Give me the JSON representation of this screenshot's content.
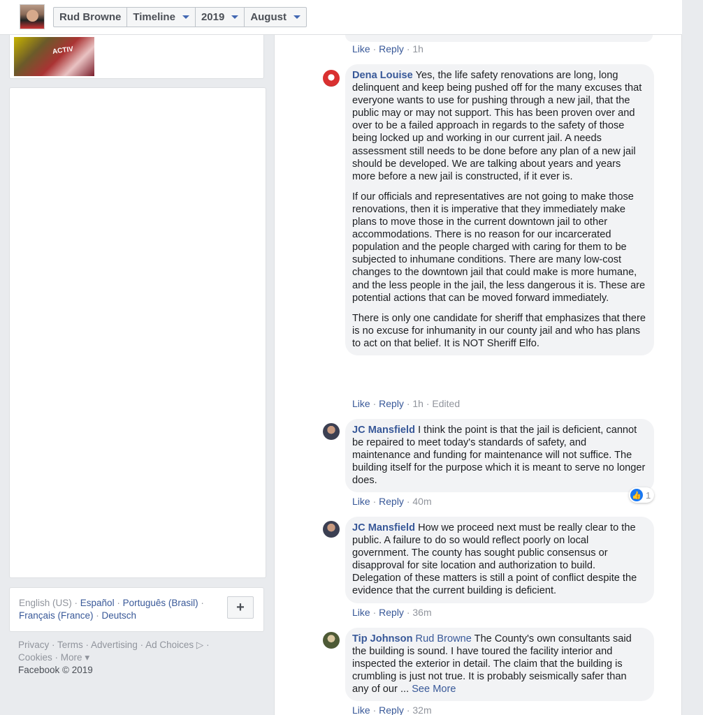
{
  "topbar": {
    "name": "Rud Browne",
    "section": "Timeline",
    "year": "2019",
    "month": "August"
  },
  "language_box": {
    "current": "English (US)",
    "languages": [
      "Español",
      "Português (Brasil)",
      "Français (France)",
      "Deutsch"
    ],
    "add_label": "+"
  },
  "footer": {
    "links": [
      "Privacy",
      "Terms",
      "Advertising",
      "Ad Choices",
      "Cookies",
      "More"
    ],
    "copyright": "Facebook © 2019"
  },
  "previous_comment_actions": {
    "like": "Like",
    "reply": "Reply",
    "time": "1h"
  },
  "comments": [
    {
      "author": "Dena Louise",
      "paragraphs": [
        "Yes, the life safety renovations are long, long delinquent and keep being pushed off for the many excuses that everyone wants to use for pushing through a new jail, that the public may or may not support. This has been proven over and over to be a failed approach in regards to the safety of those being locked up and working in our current jail. A needs assessment still needs to be done before any plan of a new jail should be developed. We are talking about years and years more before a new jail is constructed, if it ever is.",
        "If our officials and representatives are not going to make those renovations, then it is imperative that they immediately make plans to move those in the current downtown jail to other accommodations. There is no reason for our incarcerated population and the people charged with caring for them to be subjected to inhumane conditions. There are many low-cost changes to the downtown jail that could make is more humane, and the less people in the jail, the less dangerous it is. These are potential actions that can be moved forward immediately.",
        "There is only one candidate for sheriff that emphasizes that there is no excuse for inhumanity in our county jail and who has plans to act on that belief. It is NOT Sheriff Elfo."
      ],
      "like": "Like",
      "reply": "Reply",
      "time": "1h",
      "edited": "Edited"
    },
    {
      "author": "JC Mansfield",
      "text": "I think the point is that the jail is deficient, cannot be repaired to meet today's standards of safety, and maintenance and funding for maintenance will not suffice. The building itself for the purpose which it is meant to serve no longer does.",
      "like": "Like",
      "reply": "Reply",
      "time": "40m",
      "reaction_count": "1"
    },
    {
      "author": "JC Mansfield",
      "text": "How we proceed next must be really clear to the public. A failure to do so would reflect poorly on local government. The county has sought public consensus or disapproval for site location and authorization to build. Delegation of these matters is still a point of conflict despite the evidence that the current building is deficient.",
      "like": "Like",
      "reply": "Reply",
      "time": "36m"
    },
    {
      "author": "Tip Johnson",
      "mention": "Rud Browne",
      "text": "The County's own consultants said the building is sound. I have toured the facility interior and inspected the exterior in detail. The claim that the building is crumbling is just not true. It is probably seismically safer than any of our ...",
      "see_more": "See More",
      "like": "Like",
      "reply": "Reply",
      "time": "32m"
    }
  ]
}
